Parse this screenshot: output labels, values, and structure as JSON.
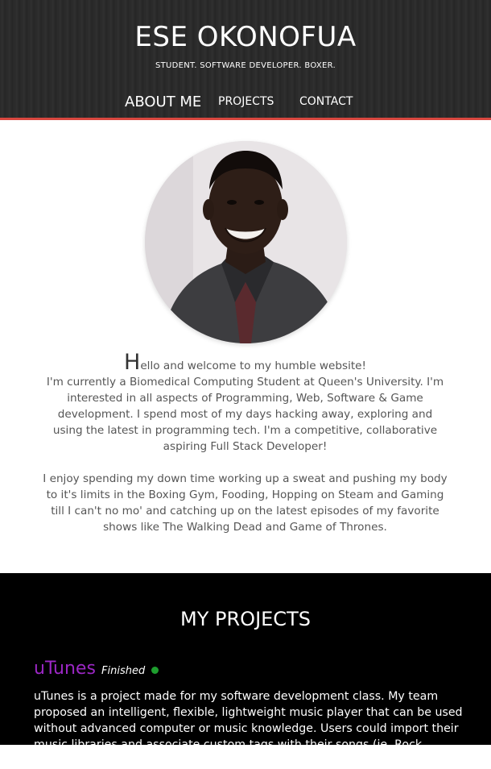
{
  "header": {
    "title": "ESE OKONOFUA",
    "tagline": "STUDENT. SOFTWARE DEVELOPER. BOXER.",
    "accent_color": "#d9473f"
  },
  "nav": {
    "about": "ABOUT ME",
    "projects": "PROJECTS",
    "contact": "CONTACT"
  },
  "about": {
    "avatar_icon": "portrait-photo",
    "greeting_initial": "H",
    "greeting_rest": "ello and welcome to my humble website!",
    "paragraph1": "I'm currently a Biomedical Computing Student at Queen's University. I'm interested in all aspects of Programming, Web, Software & Game development. I spend most of my days hacking away, exploring and using the latest in programming tech. I'm a competitive, collaborative aspiring Full Stack Developer!",
    "paragraph2": "I enjoy spending my down time working up a sweat and pushing my body to it's limits in the Boxing Gym, Fooding, Hopping on Steam and Gaming till I can't no mo' and catching up on the latest episodes of my favorite shows like The Walking Dead and Game of Thrones."
  },
  "projects": {
    "title": "MY PROJECTS",
    "items": [
      {
        "name": "uTunes",
        "status": "Finished",
        "status_color": "#1e9e2e",
        "name_color": "#9b27c4",
        "description": "uTunes is a project made for my software development class. My team proposed an intelligent, flexible, lightweight music player that can be used without advanced computer or music knowledge. Users could import their music libraries and associate custom tags with their songs (ie. Rock, Happy, Sad, Party). Users could"
      }
    ]
  }
}
